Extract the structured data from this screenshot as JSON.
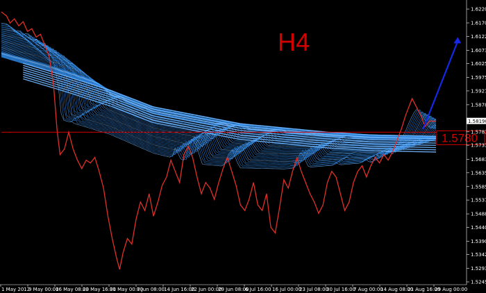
{
  "timeframe_label": "H4",
  "colors": {
    "background": "#000000",
    "price_line": "#e0302a",
    "ribbon": "#2f8ae6",
    "ribbon_bright": "#6fb6ff",
    "arrow": "#1428e6",
    "axis_text": "#ffffff",
    "label_red": "#d40000"
  },
  "current_price_label": "1.58190",
  "marked_level_label": "1.5780",
  "price_axis_ticks": [
    "1.62200",
    "1.61705",
    "1.61225",
    "1.60730",
    "1.60250",
    "1.59755",
    "1.59275",
    "1.58780",
    "1.57815",
    "1.57335",
    "1.56830",
    "1.56350",
    "1.55855",
    "1.55375",
    "1.54880",
    "1.54400",
    "1.53905",
    "1.53425",
    "1.52930",
    "1.52450"
  ],
  "time_axis_ticks": [
    "1 May 2012",
    "9 May 00:00",
    "16 May 08:00",
    "23 May 16:00",
    "31 May 00:00",
    "7 Jun 08:00",
    "14 Jun 16:00",
    "22 Jun 00:00",
    "29 Jun 08:00",
    "6 Jul 16:00",
    "16 Jul 00:00",
    "23 Jul 08:00",
    "30 Jul 16:00",
    "7 Aug 00:00",
    "14 Aug 08:00",
    "21 Aug 16:00",
    "29 Aug 00:00"
  ],
  "chart_data": {
    "type": "line",
    "price_min": 1.5245,
    "price_max": 1.624,
    "marked_level": 1.578,
    "price_series": [
      [
        0,
        1.621
      ],
      [
        0.012,
        1.6195
      ],
      [
        0.02,
        1.617
      ],
      [
        0.03,
        1.6185
      ],
      [
        0.04,
        1.616
      ],
      [
        0.05,
        1.6175
      ],
      [
        0.06,
        1.614
      ],
      [
        0.07,
        1.615
      ],
      [
        0.08,
        1.612
      ],
      [
        0.09,
        1.613
      ],
      [
        0.1,
        1.609
      ],
      [
        0.11,
        1.605
      ],
      [
        0.12,
        1.595
      ],
      [
        0.128,
        1.579
      ],
      [
        0.135,
        1.57
      ],
      [
        0.145,
        1.572
      ],
      [
        0.155,
        1.578
      ],
      [
        0.165,
        1.572
      ],
      [
        0.175,
        1.568
      ],
      [
        0.185,
        1.565
      ],
      [
        0.195,
        1.568
      ],
      [
        0.205,
        1.567
      ],
      [
        0.215,
        1.569
      ],
      [
        0.225,
        1.564
      ],
      [
        0.235,
        1.558
      ],
      [
        0.245,
        1.548
      ],
      [
        0.255,
        1.54
      ],
      [
        0.265,
        1.533
      ],
      [
        0.272,
        1.529
      ],
      [
        0.28,
        1.535
      ],
      [
        0.29,
        1.54
      ],
      [
        0.3,
        1.538
      ],
      [
        0.31,
        1.547
      ],
      [
        0.32,
        1.553
      ],
      [
        0.33,
        1.55
      ],
      [
        0.34,
        1.556
      ],
      [
        0.35,
        1.548
      ],
      [
        0.36,
        1.553
      ],
      [
        0.37,
        1.559
      ],
      [
        0.38,
        1.562
      ],
      [
        0.39,
        1.568
      ],
      [
        0.4,
        1.564
      ],
      [
        0.41,
        1.56
      ],
      [
        0.42,
        1.57
      ],
      [
        0.43,
        1.573
      ],
      [
        0.44,
        1.569
      ],
      [
        0.45,
        1.562
      ],
      [
        0.46,
        1.556
      ],
      [
        0.47,
        1.56
      ],
      [
        0.48,
        1.558
      ],
      [
        0.49,
        1.554
      ],
      [
        0.5,
        1.56
      ],
      [
        0.51,
        1.565
      ],
      [
        0.52,
        1.569
      ],
      [
        0.53,
        1.564
      ],
      [
        0.54,
        1.559
      ],
      [
        0.55,
        1.552
      ],
      [
        0.56,
        1.55
      ],
      [
        0.57,
        1.554
      ],
      [
        0.58,
        1.56
      ],
      [
        0.59,
        1.552
      ],
      [
        0.6,
        1.55
      ],
      [
        0.61,
        1.556
      ],
      [
        0.62,
        1.544
      ],
      [
        0.63,
        1.542
      ],
      [
        0.64,
        1.551
      ],
      [
        0.65,
        1.561
      ],
      [
        0.66,
        1.558
      ],
      [
        0.67,
        1.564
      ],
      [
        0.68,
        1.569
      ],
      [
        0.69,
        1.564
      ],
      [
        0.7,
        1.56
      ],
      [
        0.71,
        1.556
      ],
      [
        0.72,
        1.553
      ],
      [
        0.73,
        1.549
      ],
      [
        0.74,
        1.552
      ],
      [
        0.75,
        1.56
      ],
      [
        0.76,
        1.564
      ],
      [
        0.77,
        1.562
      ],
      [
        0.78,
        1.556
      ],
      [
        0.79,
        1.55
      ],
      [
        0.8,
        1.553
      ],
      [
        0.81,
        1.56
      ],
      [
        0.82,
        1.564
      ],
      [
        0.83,
        1.566
      ],
      [
        0.84,
        1.562
      ],
      [
        0.85,
        1.566
      ],
      [
        0.86,
        1.569
      ],
      [
        0.87,
        1.567
      ],
      [
        0.88,
        1.57
      ],
      [
        0.89,
        1.568
      ],
      [
        0.9,
        1.571
      ],
      [
        0.91,
        1.575
      ],
      [
        0.92,
        1.579
      ],
      [
        0.93,
        1.584
      ],
      [
        0.94,
        1.588
      ],
      [
        0.945,
        1.59
      ],
      [
        0.955,
        1.587
      ],
      [
        0.965,
        1.584
      ],
      [
        0.975,
        1.58
      ],
      [
        0.985,
        1.582
      ],
      [
        1.0,
        1.5819
      ]
    ],
    "ribbon_center": [
      [
        0,
        1.605
      ],
      [
        0.15,
        1.598
      ],
      [
        0.25,
        1.593
      ],
      [
        0.35,
        1.587
      ],
      [
        0.45,
        1.584
      ],
      [
        0.55,
        1.581
      ],
      [
        0.65,
        1.5795
      ],
      [
        0.75,
        1.578
      ],
      [
        0.85,
        1.577
      ],
      [
        1.0,
        1.5765
      ]
    ],
    "ribbon_floor": [
      [
        0,
        1.579
      ],
      [
        0.12,
        1.578
      ],
      [
        0.25,
        1.572
      ],
      [
        0.35,
        1.565
      ],
      [
        0.45,
        1.561
      ],
      [
        0.55,
        1.56
      ],
      [
        0.65,
        1.56
      ],
      [
        0.75,
        1.562
      ],
      [
        0.85,
        1.564
      ],
      [
        1.0,
        1.566
      ]
    ],
    "arrow": {
      "from": [
        0.97,
        1.579
      ],
      "to": [
        1.05,
        1.612
      ]
    }
  }
}
